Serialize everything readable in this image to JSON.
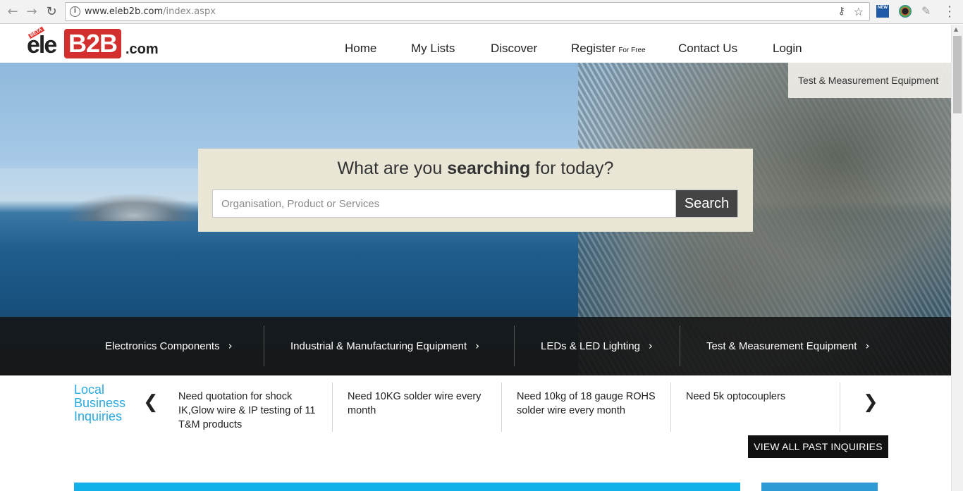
{
  "browser": {
    "url_host": "www.eleb2b.com",
    "url_path": "/index.aspx",
    "ext_new_label": "NEW"
  },
  "logo": {
    "beta": "BETA",
    "ele": "ele",
    "b2b": "B2B",
    "com": ".com"
  },
  "nav": {
    "home": "Home",
    "my_lists": "My Lists",
    "discover": "Discover",
    "register": "Register",
    "register_note": "For Free",
    "contact": "Contact Us",
    "login": "Login"
  },
  "hero": {
    "corner_link": "Test & Measurement Equipment",
    "search_title_pre": "What are you",
    "search_title_bold": "searching",
    "search_title_post": "for today?",
    "search_placeholder": "Organisation, Product or Services",
    "search_value": "",
    "search_button": "Search"
  },
  "categories": [
    {
      "label": "Electronics Components"
    },
    {
      "label": "Industrial & Manufacturing Equipment"
    },
    {
      "label": "LEDs & LED Lighting"
    },
    {
      "label": "Test & Measurement Equipment"
    }
  ],
  "inquiries": {
    "title": "Local Business Inquiries",
    "items": [
      {
        "text": "Need quotation for shock IK,Glow wire & IP testing of 11 T&M products"
      },
      {
        "text": "Need 10KG solder wire every month"
      },
      {
        "text": "Need 10kg of 18 gauge ROHS solder wire every month"
      },
      {
        "text": "Need 5k optocouplers"
      }
    ],
    "view_all": "VIEW ALL PAST INQUIRIES"
  },
  "icons": {
    "back": "arrow-left-icon",
    "forward": "arrow-right-icon",
    "reload": "reload-icon",
    "info": "info-icon",
    "key": "key-icon",
    "bookmark": "star-icon",
    "category_chevron": "chevron-right-icon",
    "carousel_prev": "chevron-left-icon",
    "carousel_next": "chevron-right-icon"
  },
  "colors": {
    "brand_red": "#d32f2f",
    "accent_blue": "#29a8e0",
    "search_panel": "#eae6d6",
    "search_button": "#444444",
    "category_bar": "#141414"
  }
}
